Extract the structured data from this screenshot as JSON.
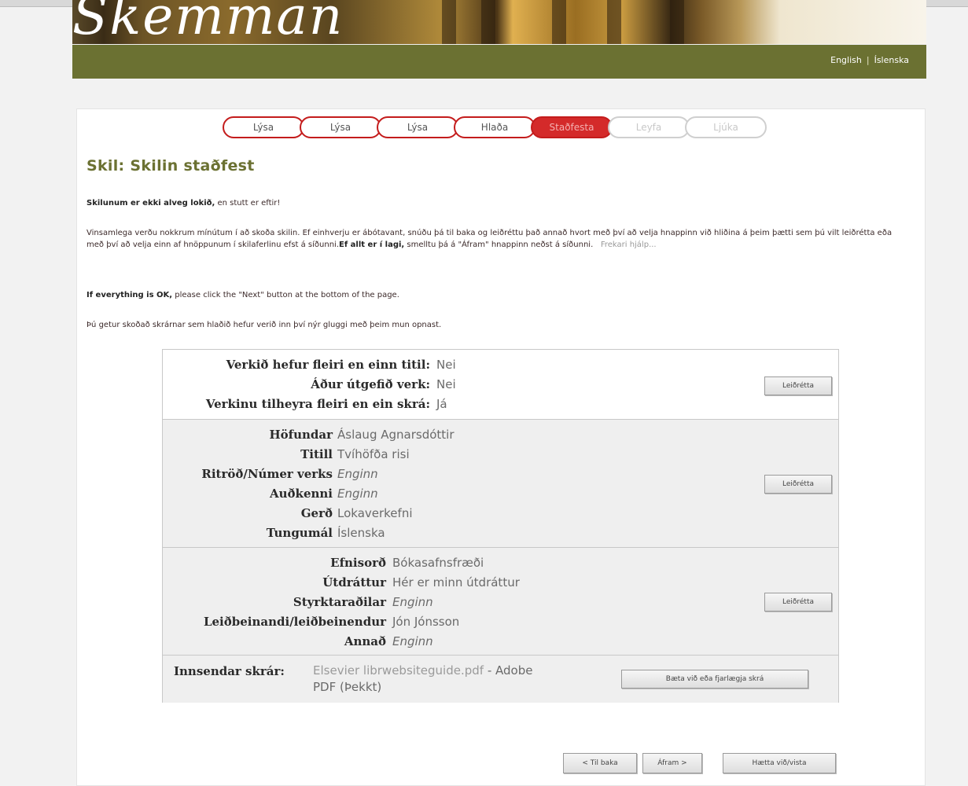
{
  "header": {
    "logo_text": "Skemman",
    "lang_english": "English",
    "lang_separator": "|",
    "lang_icelandic": "Íslenska"
  },
  "steps": [
    {
      "label": "Lýsa",
      "state": "done"
    },
    {
      "label": "Lýsa",
      "state": "done"
    },
    {
      "label": "Lýsa",
      "state": "done"
    },
    {
      "label": "Hlaða",
      "state": "done"
    },
    {
      "label": "Staðfesta",
      "state": "active"
    },
    {
      "label": "Leyfa",
      "state": "disabled"
    },
    {
      "label": "Ljúka",
      "state": "disabled"
    }
  ],
  "page_title": "Skil: Skilin staðfest",
  "intro": {
    "bold": "Skilunum er ekki alveg lokið,",
    "rest": " en stutt er eftir!"
  },
  "instructions": {
    "text": "Vinsamlega verðu nokkrum mínútum í að skoða skilin. Ef einhverju er ábótavant, snúðu þá til baka og leiðréttu það annað hvort með því að velja hnappinn við hliðina á þeim þætti sem þú vilt leiðrétta eða með því að velja einn af hnöppunum í skilaferlinu efst á síðunni.",
    "bold": "Ef allt er í lagi,",
    "text2": " smelltu þá á \"Áfram\" hnappinn neðst á síðunni.",
    "help_link": "Frekari hjálp..."
  },
  "english_note": {
    "bold": "If everything is OK,",
    "rest": " please click the \"Next\" button at the bottom of the page."
  },
  "files_note": "Þú getur skoðað skrárnar sem hlaðið hefur verið inn því nýr gluggi með þeim mun opnast.",
  "sections": {
    "s1": {
      "rows": [
        {
          "label": "Verkið hefur fleiri en einn titil:",
          "value": "Nei"
        },
        {
          "label": "Áður útgefið verk:",
          "value": "Nei"
        },
        {
          "label": "Verkinu tilheyra fleiri en ein skrá:",
          "value": "Já"
        }
      ],
      "button": "Leiðrétta"
    },
    "s2": {
      "rows": [
        {
          "label": "Höfundar",
          "value": "Áslaug Agnarsdóttir"
        },
        {
          "label": "Titill",
          "value": "Tvíhöfða risi"
        },
        {
          "label": "Ritröð/Númer verks",
          "value": "Enginn"
        },
        {
          "label": "Auðkenni",
          "value": "Enginn"
        },
        {
          "label": "Gerð",
          "value": "Lokaverkefni"
        },
        {
          "label": "Tungumál",
          "value": "Íslenska"
        }
      ],
      "button": "Leiðrétta"
    },
    "s3": {
      "rows": [
        {
          "label": "Efnisorð",
          "value": "Bókasafnsfræði"
        },
        {
          "label": "Útdráttur",
          "value": "Hér er minn útdráttur"
        },
        {
          "label": "Styrktaraðilar",
          "value": "Enginn"
        },
        {
          "label": "Leiðbeinandi/leiðbeinendur",
          "value": "Jón Jónsson"
        },
        {
          "label": "Annað",
          "value": "Enginn"
        }
      ],
      "button": "Leiðrétta"
    },
    "s4": {
      "label": "Innsendar skrár:",
      "file_link": "Elsevier librwebsiteguide.pdf",
      "file_type_line1": " - Adobe",
      "file_type_line2": "PDF (Þekkt)",
      "button": "Bæta við eða fjarlægja skrá"
    }
  },
  "footer_buttons": {
    "back": "< Til baka",
    "next": "Áfram >",
    "cancel": "Hætta við/vista"
  },
  "colors": {
    "accent_green": "#6b7132",
    "step_red": "#c41c1c"
  }
}
